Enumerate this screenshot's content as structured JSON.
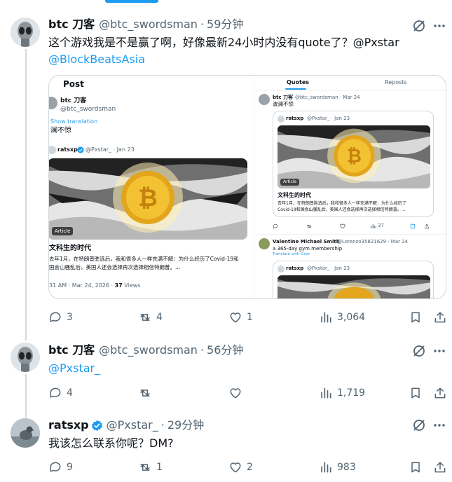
{
  "tweets": [
    {
      "name": "btc 刀客",
      "handle": "@btc_swordsman",
      "sep": "·",
      "time": "59分钟",
      "text_line1": "这个游戏我是不是赢了啊，好像最新24小时内没有quote了？@Pxstar",
      "text_line2": "@BlockBeatsAsia",
      "replies": "3",
      "retweets": "4",
      "likes": "1",
      "views": "3,064"
    },
    {
      "name": "btc 刀客",
      "handle": "@btc_swordsman",
      "sep": "·",
      "time": "56分钟",
      "text": "@Pxstar_",
      "replies": "4",
      "retweets": "",
      "likes": "",
      "views": "1,719"
    },
    {
      "name": "ratsxp",
      "handle": "@Pxstar_",
      "sep": "·",
      "time": "29分钟",
      "text": "我该怎么联系你呢？DM?",
      "replies": "9",
      "retweets": "1",
      "likes": "2",
      "views": "983"
    }
  ],
  "embedded": {
    "left": {
      "header": "Post",
      "name": "btc 刀客",
      "handle": "@btc_swordsman",
      "show_translation": "Show translation",
      "text": "澜不惊",
      "quoted_name": "ratsxp",
      "quoted_handle": "@Pxstar_ · Jan 23",
      "article_tag": "Article",
      "title": "文科生的时代",
      "body1": "去年1月，在特朗普胜选后，我和很多人一样充满不解：为什么经历了Covid-19和",
      "body2": "国会山骚乱后，美国人还会选择再次选择相信特朗普。...",
      "meta_time": "31 AM · Mar 24, 2026 · ",
      "meta_views": "37",
      "meta_views_label": " Views"
    },
    "right": {
      "tab_quotes": "Quotes",
      "tab_reposts": "Reposts",
      "name": "btc 刀客",
      "handle": "@btc_swordsman · Mar 24",
      "text": "波澜不惊",
      "quoted_name": "ratsxp",
      "quoted_handle": "@Pxstar_ · Jan 23",
      "article_tag": "Article",
      "title": "文科生的时代",
      "body1": "去年1月，在特朗普胜选后，我和很多人一样充满不解：为什么经历了",
      "body2": "Covid-19和国会山骚乱后，美国人还会选择再次选择相信特朗普。...",
      "views": "37",
      "name2": "Valentine Michael Smith",
      "handle2": "@Lorenzo35821629 · Mar 24",
      "text2": "a 365-day gym membership",
      "translate2": "Translate with Grok",
      "quoted2_handle": "@Pxstar_ · Jan 23"
    }
  },
  "colors": {
    "accent": "#1d9bf0",
    "text": "#0f1419",
    "muted": "#536471",
    "border": "#cfd9de",
    "verified": "#1d9bf0"
  },
  "icons": [
    "reply-icon",
    "retweet-icon",
    "like-icon",
    "views-icon",
    "bookmark-icon",
    "share-icon",
    "grok-icon",
    "more-icon",
    "verified-icon"
  ]
}
